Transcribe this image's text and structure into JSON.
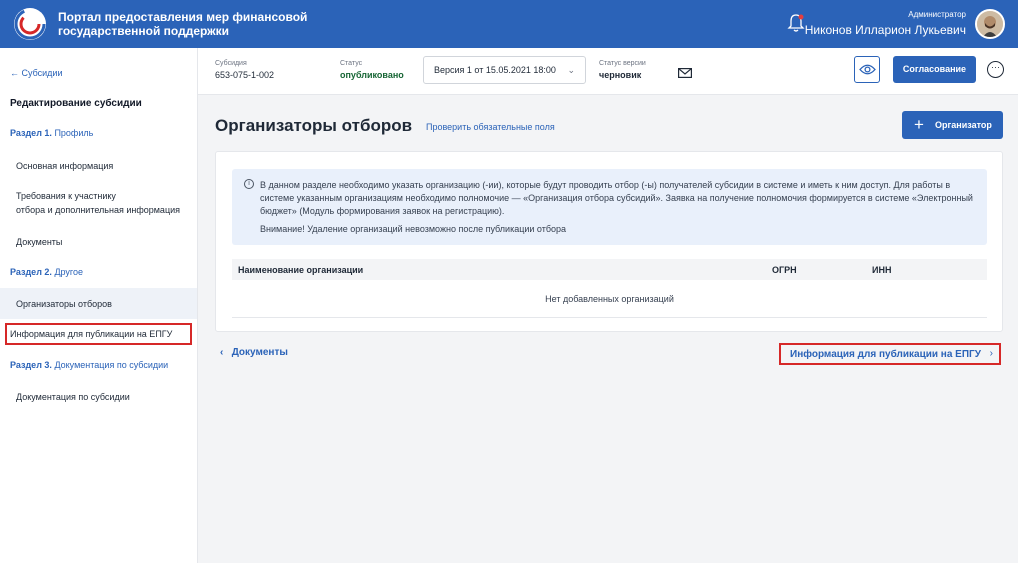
{
  "header": {
    "title": "Портал предоставления мер финансовой государственной поддержки",
    "user_role": "Администратор",
    "user_name": "Никонов Илларион Лукьевич"
  },
  "sidebar": {
    "back_label": "← Субсидии",
    "edit_title": "Редактирование субсидии",
    "sections": [
      {
        "prefix": "Раздел 1.",
        "label": "Профиль"
      },
      {
        "prefix": "Раздел 2.",
        "label": "Другое"
      },
      {
        "prefix": "Раздел 3.",
        "label": "Документация по субсидии"
      }
    ],
    "items": [
      "Основная информация",
      "Требования к участнику",
      "отбора и дополнительная информация",
      "Документы",
      "Организаторы отборов",
      "Информация для публикации на ЕПГУ",
      "Документация по субсидии"
    ]
  },
  "toolbar": {
    "subsidy_label": "Субсидия",
    "subsidy_value": "653-075-1-002",
    "status_label": "Статус",
    "status_value": "опубликовано",
    "version_value": "Версия 1 от 15.05.2021 18:00",
    "version_status_label": "Статус версии",
    "version_status_value": "черновик",
    "approve_label": "Согласование",
    "more_label": "···"
  },
  "main": {
    "title": "Организаторы отборов",
    "check_link": "Проверить обязательные поля",
    "org_button": "Организатор",
    "info_text": "В данном разделе необходимо указать организацию (-ии), которые будут проводить отбор (-ы) получателей субсидии в системе и иметь к ним доступ. Для работы в системе указанным организациям необходимо полномочие — «Организация отбора субсидий». Заявка на получение полномочия формируется в системе «Электронный бюджет» (Модуль формирования заявок на регистрацию).",
    "info_warning": "Внимание! Удаление организаций невозможно после публикации отбора",
    "table_columns": [
      "Наименование организации",
      "ОГРН",
      "ИНН"
    ],
    "empty_text": "Нет добавленных организаций",
    "nav_prev": "Документы",
    "nav_next": "Информация для публикации на ЕПГУ"
  },
  "colors": {
    "brand": "#2b63b8",
    "status_green": "#166534",
    "highlight_red": "#d62828"
  }
}
